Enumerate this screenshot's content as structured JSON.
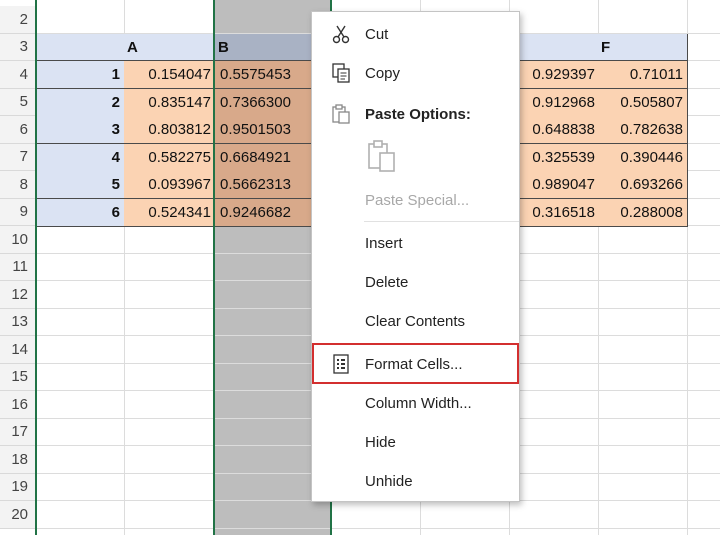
{
  "sheet": {
    "row_numbers": [
      "2",
      "3",
      "4",
      "5",
      "6",
      "7",
      "8",
      "9",
      "10",
      "11",
      "12",
      "13",
      "14",
      "15",
      "16",
      "17",
      "18",
      "19",
      "20"
    ],
    "col_headers": {
      "A": "A",
      "B": "B",
      "F": "F"
    },
    "data_rows": [
      {
        "idx": "1",
        "A": "0.154047",
        "B": "0.5575453",
        "F_prev": "0.929397",
        "F": "0.71011"
      },
      {
        "idx": "2",
        "A": "0.835147",
        "B": "0.7366300",
        "F_prev": "0.912968",
        "F": "0.505807"
      },
      {
        "idx": "3",
        "A": "0.803812",
        "B": "0.9501503",
        "F_prev": "0.648838",
        "F": "0.782638"
      },
      {
        "idx": "4",
        "A": "0.582275",
        "B": "0.6684921",
        "F_prev": "0.325539",
        "F": "0.390446"
      },
      {
        "idx": "5",
        "A": "0.093967",
        "B": "0.5662313",
        "F_prev": "0.989047",
        "F": "0.693266"
      },
      {
        "idx": "6",
        "A": "0.524341",
        "B": "0.9246682",
        "F_prev": "0.316518",
        "F": "0.288008"
      }
    ]
  },
  "context_menu": {
    "cut": "Cut",
    "copy": "Copy",
    "paste_options": "Paste Options:",
    "paste_special": "Paste Special...",
    "insert": "Insert",
    "delete": "Delete",
    "clear_contents": "Clear Contents",
    "format_cells": "Format Cells...",
    "column_width": "Column Width...",
    "hide": "Hide",
    "unhide": "Unhide"
  },
  "colors": {
    "header_fill": "#dbe3f3",
    "value_fill": "#fbd3b3",
    "selected_column": "#bdbdbd",
    "selection_border": "#217346",
    "highlight_border": "#d32f2f"
  }
}
